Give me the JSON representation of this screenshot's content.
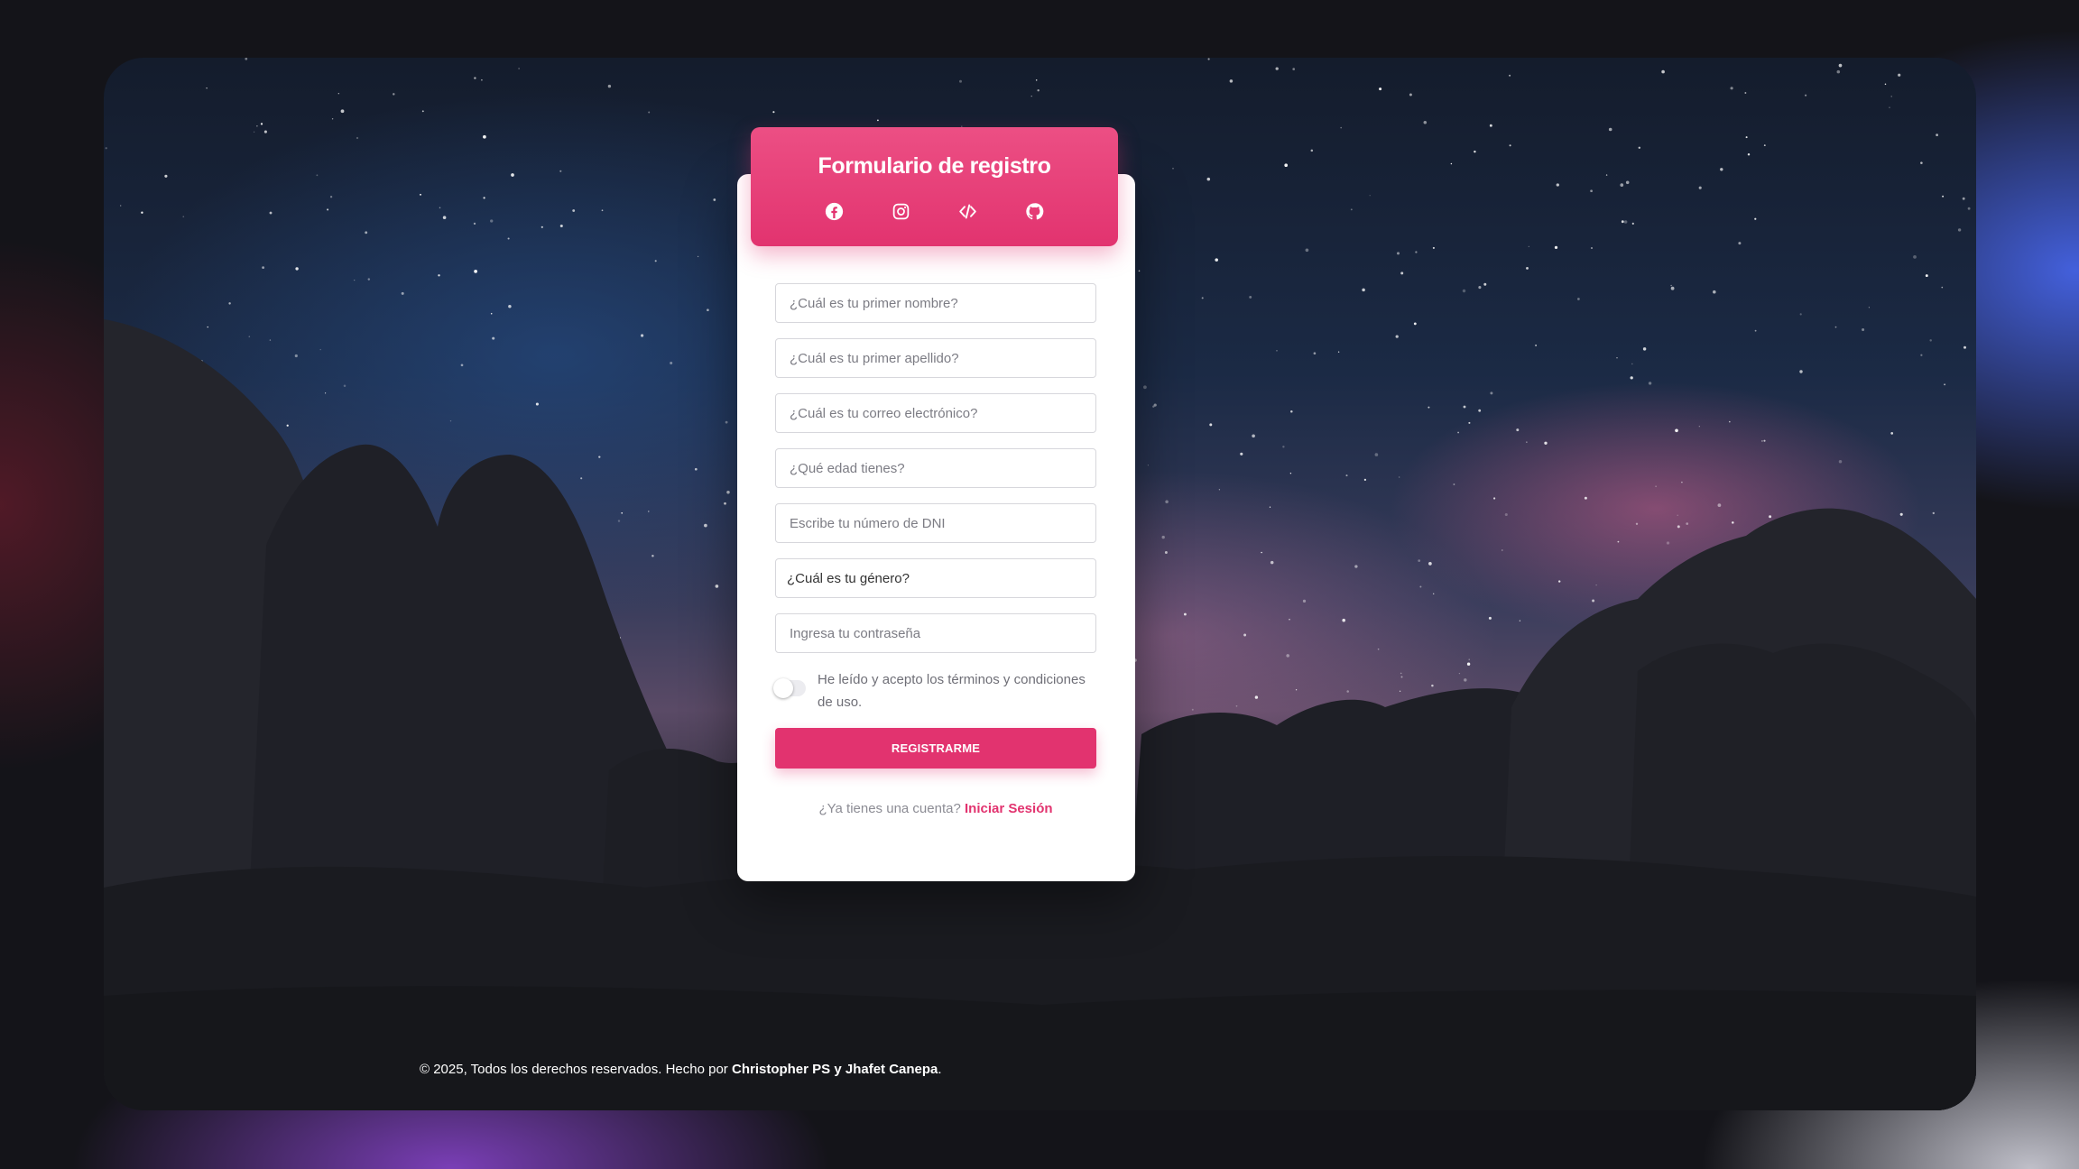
{
  "colors": {
    "accent": "#e2336f",
    "card_background": "#ffffff",
    "placeholder_text": "#7c7c84"
  },
  "header": {
    "title": "Formulario de registro",
    "social_icons": [
      "facebook-icon",
      "instagram-icon",
      "code-icon",
      "github-icon"
    ]
  },
  "form": {
    "first_name_placeholder": "¿Cuál es tu primer nombre?",
    "last_name_placeholder": "¿Cuál es tu primer apellido?",
    "email_placeholder": "¿Cuál es tu correo electrónico?",
    "age_placeholder": "¿Qué edad tienes?",
    "dni_placeholder": "Escribe tu número de DNI",
    "gender_selected": "¿Cuál es tu género?",
    "password_placeholder": "Ingresa tu contraseña",
    "terms_text": "He leído y acepto los términos y condiciones de uso.",
    "terms_accepted": false,
    "submit_label": "REGISTRARME",
    "login_prompt": "¿Ya tienes una cuenta?",
    "login_link": "Iniciar Sesión"
  },
  "footer": {
    "prefix": "© 2025, Todos los derechos reservados. Hecho por",
    "author1": "Christopher PS",
    "joiner": "y",
    "author2": "Jhafet Canepa",
    "suffix": "."
  }
}
